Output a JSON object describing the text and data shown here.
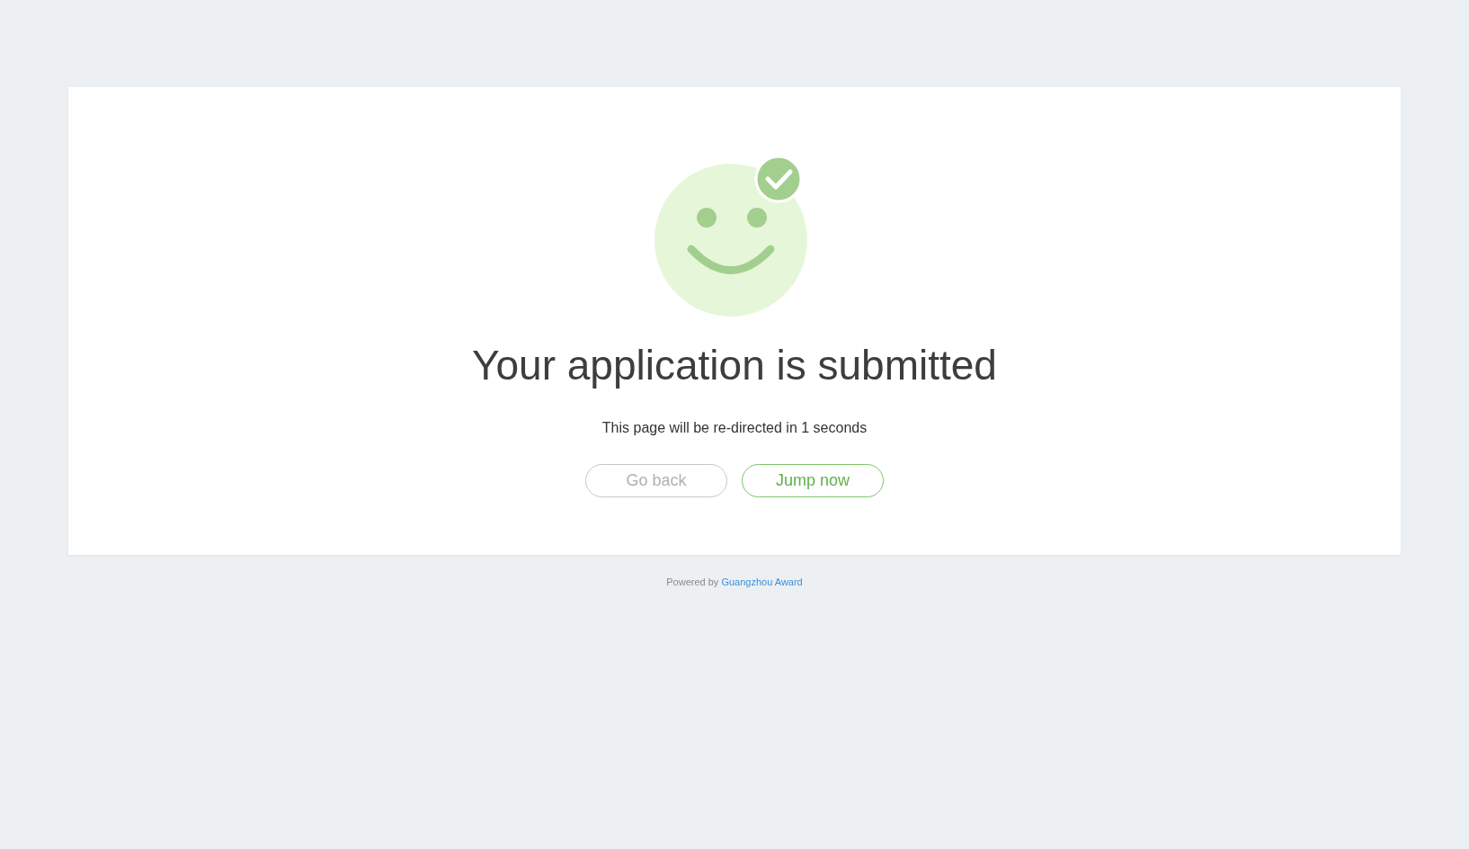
{
  "result": {
    "title": "Your application is submitted",
    "message": "This page will be re-directed in 1 seconds"
  },
  "buttons": [
    {
      "label": "Go back",
      "kind": "secondary"
    },
    {
      "label": "Jump now",
      "kind": "primary"
    }
  ],
  "footer": {
    "prefix": "Powered by",
    "link": "Guangzhou Award"
  }
}
